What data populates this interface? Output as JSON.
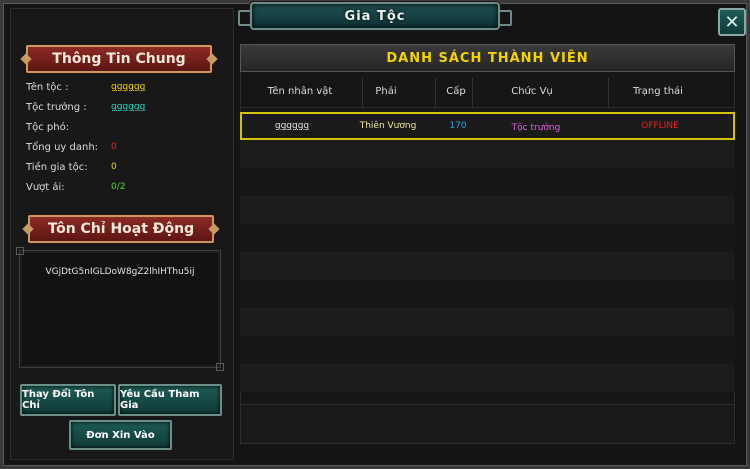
{
  "window": {
    "title": "Gia Tộc"
  },
  "close_glyph": "✕",
  "general_info": {
    "header": "Thông Tin Chung",
    "rows": [
      {
        "label": "Tên tộc :",
        "value": "gggggg",
        "color": "#f2d100"
      },
      {
        "label": "Tộc trưởng :",
        "value": "gggggg",
        "color": "#28d8c8"
      },
      {
        "label": "Tộc phó:",
        "value": "",
        "color": "#dcdcdc"
      },
      {
        "label": "Tổng uy danh:",
        "value": "0",
        "color": "#e62020"
      },
      {
        "label": "Tiền gia tộc:",
        "value": "0",
        "color": "#f2d100"
      },
      {
        "label": "Vượt ải:",
        "value": "0/2",
        "color": "#4fd83c"
      }
    ]
  },
  "motto": {
    "header": "Tôn Chỉ Hoạt Động",
    "text": "VGjDtG5nIGLDoW8gZ2lhIHThu5ij"
  },
  "buttons": {
    "change_motto": "Thay Đổi Tôn Chỉ",
    "request_join": "Yêu Cầu Tham Gia",
    "applications": "Đơn Xin Vào"
  },
  "member_list": {
    "title": "DANH SÁCH THÀNH VIÊN",
    "columns": [
      "Tên nhân vật",
      "Phái",
      "Cấp",
      "Chức Vụ",
      "Trạng thái"
    ],
    "rows": [
      {
        "name": "gggggg",
        "faction": "Thiên Vương",
        "level": "170",
        "role": "Tộc trưởng",
        "status": "OFFLINE"
      }
    ]
  },
  "colors": {
    "level": "#28a8e8",
    "role": "#e060e0",
    "status_offline": "#f02020",
    "highlight": "#d4c400",
    "list_title": "#f5d400"
  }
}
